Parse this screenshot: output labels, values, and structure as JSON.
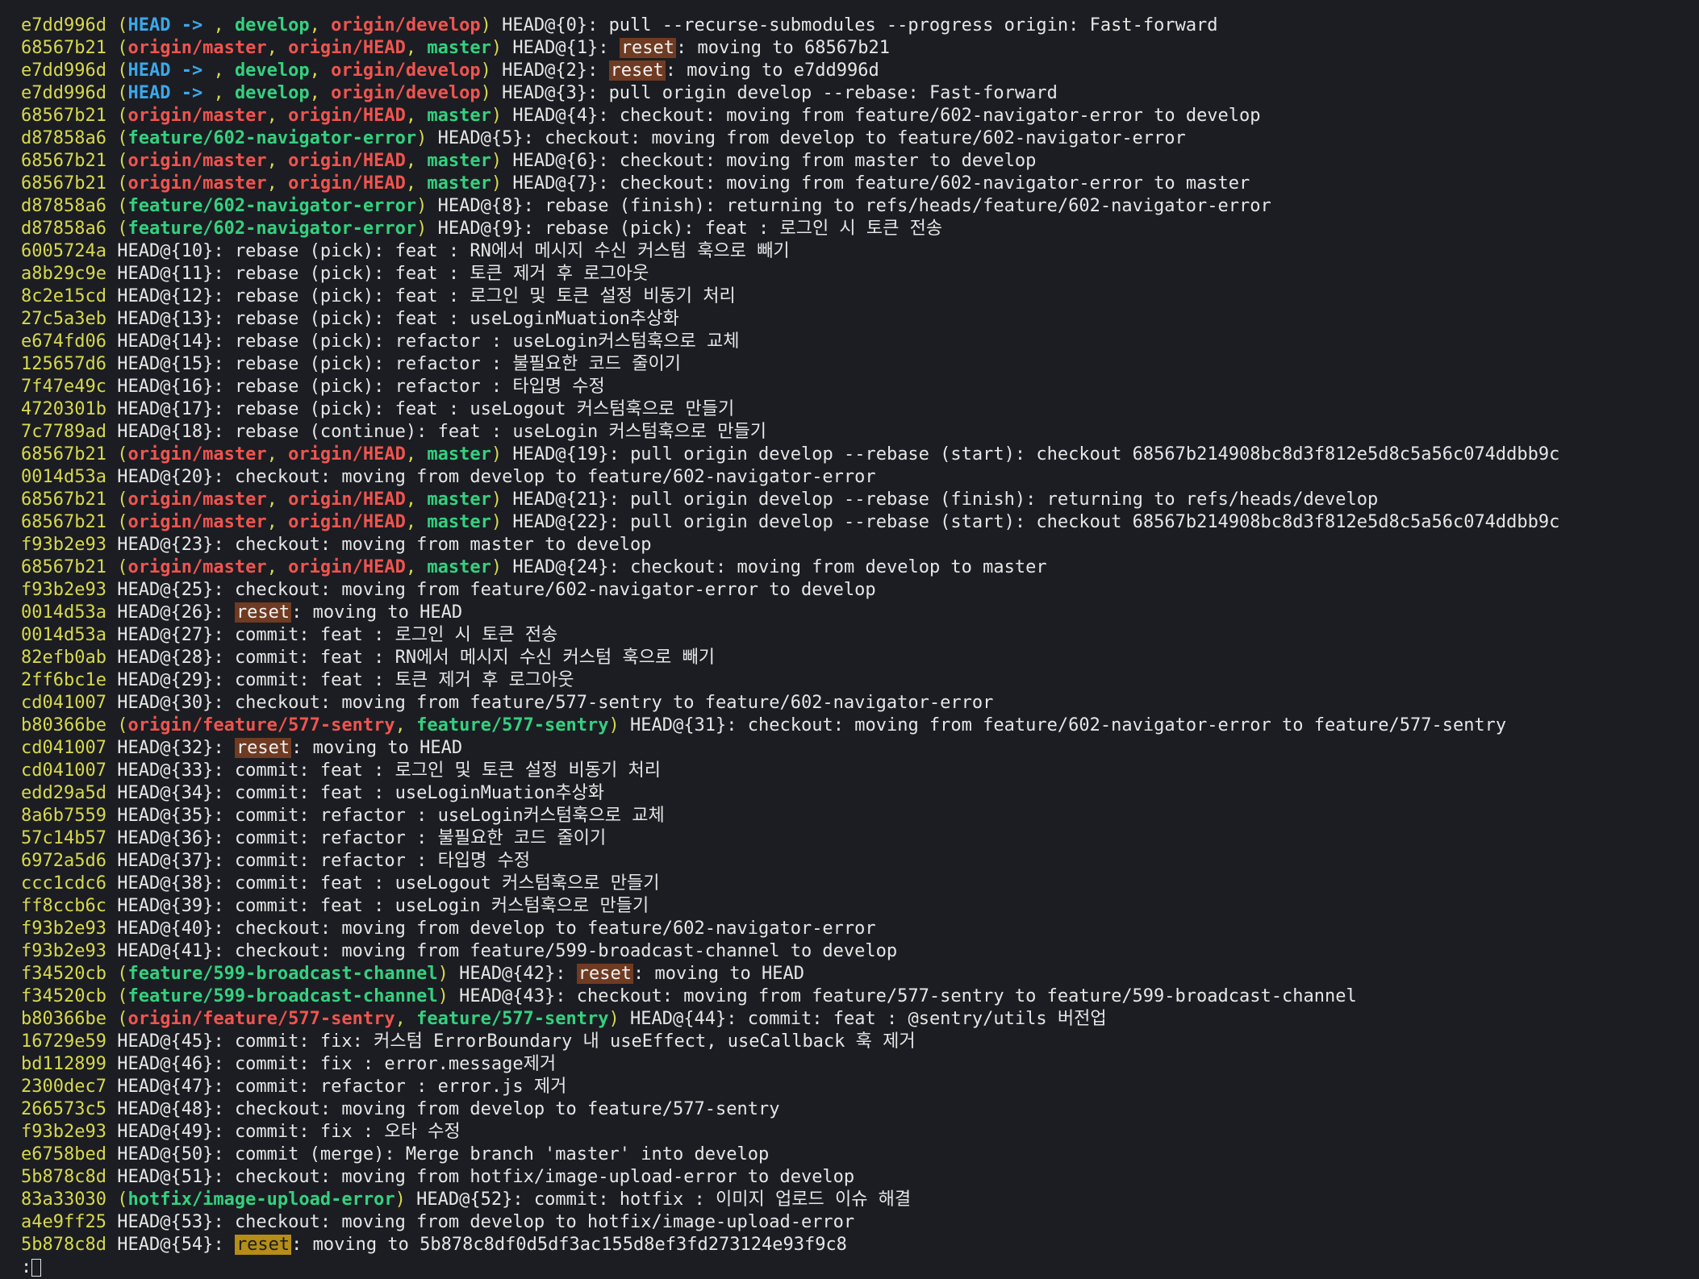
{
  "prompt": ":",
  "colors": {
    "hash": "#d7d84f",
    "head": "#3aa8ec",
    "local_branch": "#34d17f",
    "remote_branch": "#f0544f",
    "reset_highlight": "#6f3b22",
    "reset_highlight_active": "#b58d17",
    "background": "#1b1d22"
  },
  "entries": [
    {
      "hash": "e7dd996d",
      "refs": [
        {
          "text": "HEAD",
          "kind": "head",
          "arrow": true
        },
        {
          "text": "develop",
          "kind": "local"
        },
        {
          "text": "origin/develop",
          "kind": "remote"
        }
      ],
      "selector": "HEAD@{0}",
      "action": "pull --recurse-submodules --progress origin",
      "message": "Fast-forward"
    },
    {
      "hash": "68567b21",
      "refs": [
        {
          "text": "origin/master",
          "kind": "remote"
        },
        {
          "text": "origin/HEAD",
          "kind": "remote"
        },
        {
          "text": "master",
          "kind": "local"
        }
      ],
      "selector": "HEAD@{1}",
      "action": "reset",
      "message": "moving to 68567b21"
    },
    {
      "hash": "e7dd996d",
      "refs": [
        {
          "text": "HEAD",
          "kind": "head",
          "arrow": true
        },
        {
          "text": "develop",
          "kind": "local"
        },
        {
          "text": "origin/develop",
          "kind": "remote"
        }
      ],
      "selector": "HEAD@{2}",
      "action": "reset",
      "message": "moving to e7dd996d"
    },
    {
      "hash": "e7dd996d",
      "refs": [
        {
          "text": "HEAD",
          "kind": "head",
          "arrow": true
        },
        {
          "text": "develop",
          "kind": "local"
        },
        {
          "text": "origin/develop",
          "kind": "remote"
        }
      ],
      "selector": "HEAD@{3}",
      "action": "pull origin develop --rebase",
      "message": "Fast-forward"
    },
    {
      "hash": "68567b21",
      "refs": [
        {
          "text": "origin/master",
          "kind": "remote"
        },
        {
          "text": "origin/HEAD",
          "kind": "remote"
        },
        {
          "text": "master",
          "kind": "local"
        }
      ],
      "selector": "HEAD@{4}",
      "action": "checkout",
      "message": "moving from feature/602-navigator-error to develop"
    },
    {
      "hash": "d87858a6",
      "refs": [
        {
          "text": "feature/602-navigator-error",
          "kind": "local"
        }
      ],
      "selector": "HEAD@{5}",
      "action": "checkout",
      "message": "moving from develop to feature/602-navigator-error"
    },
    {
      "hash": "68567b21",
      "refs": [
        {
          "text": "origin/master",
          "kind": "remote"
        },
        {
          "text": "origin/HEAD",
          "kind": "remote"
        },
        {
          "text": "master",
          "kind": "local"
        }
      ],
      "selector": "HEAD@{6}",
      "action": "checkout",
      "message": "moving from master to develop"
    },
    {
      "hash": "68567b21",
      "refs": [
        {
          "text": "origin/master",
          "kind": "remote"
        },
        {
          "text": "origin/HEAD",
          "kind": "remote"
        },
        {
          "text": "master",
          "kind": "local"
        }
      ],
      "selector": "HEAD@{7}",
      "action": "checkout",
      "message": "moving from feature/602-navigator-error to master"
    },
    {
      "hash": "d87858a6",
      "refs": [
        {
          "text": "feature/602-navigator-error",
          "kind": "local"
        }
      ],
      "selector": "HEAD@{8}",
      "action": "rebase (finish)",
      "message": "returning to refs/heads/feature/602-navigator-error"
    },
    {
      "hash": "d87858a6",
      "refs": [
        {
          "text": "feature/602-navigator-error",
          "kind": "local"
        }
      ],
      "selector": "HEAD@{9}",
      "action": "rebase (pick)",
      "message": "feat : 로그인 시 토큰 전송"
    },
    {
      "hash": "6005724a",
      "refs": [],
      "selector": "HEAD@{10}",
      "action": "rebase (pick)",
      "message": "feat : RN에서 메시지 수신 커스텀 훅으로 빼기"
    },
    {
      "hash": "a8b29c9e",
      "refs": [],
      "selector": "HEAD@{11}",
      "action": "rebase (pick)",
      "message": "feat : 토큰 제거 후 로그아웃"
    },
    {
      "hash": "8c2e15cd",
      "refs": [],
      "selector": "HEAD@{12}",
      "action": "rebase (pick)",
      "message": "feat : 로그인 및 토큰 설정 비동기 처리"
    },
    {
      "hash": "27c5a3eb",
      "refs": [],
      "selector": "HEAD@{13}",
      "action": "rebase (pick)",
      "message": "feat : useLoginMuation추상화"
    },
    {
      "hash": "e674fd06",
      "refs": [],
      "selector": "HEAD@{14}",
      "action": "rebase (pick)",
      "message": "refactor : useLogin커스텀훅으로 교체"
    },
    {
      "hash": "125657d6",
      "refs": [],
      "selector": "HEAD@{15}",
      "action": "rebase (pick)",
      "message": "refactor : 불필요한 코드 줄이기"
    },
    {
      "hash": "7f47e49c",
      "refs": [],
      "selector": "HEAD@{16}",
      "action": "rebase (pick)",
      "message": "refactor : 타입명 수정"
    },
    {
      "hash": "4720301b",
      "refs": [],
      "selector": "HEAD@{17}",
      "action": "rebase (pick)",
      "message": "feat : useLogout 커스텀훅으로 만들기"
    },
    {
      "hash": "7c7789ad",
      "refs": [],
      "selector": "HEAD@{18}",
      "action": "rebase (continue)",
      "message": "feat : useLogin 커스텀훅으로 만들기"
    },
    {
      "hash": "68567b21",
      "refs": [
        {
          "text": "origin/master",
          "kind": "remote"
        },
        {
          "text": "origin/HEAD",
          "kind": "remote"
        },
        {
          "text": "master",
          "kind": "local"
        }
      ],
      "selector": "HEAD@{19}",
      "action": "pull origin develop --rebase (start)",
      "message": "checkout 68567b214908bc8d3f812e5d8c5a56c074ddbb9c"
    },
    {
      "hash": "0014d53a",
      "refs": [],
      "selector": "HEAD@{20}",
      "action": "checkout",
      "message": "moving from develop to feature/602-navigator-error"
    },
    {
      "hash": "68567b21",
      "refs": [
        {
          "text": "origin/master",
          "kind": "remote"
        },
        {
          "text": "origin/HEAD",
          "kind": "remote"
        },
        {
          "text": "master",
          "kind": "local"
        }
      ],
      "selector": "HEAD@{21}",
      "action": "pull origin develop --rebase (finish)",
      "message": "returning to refs/heads/develop"
    },
    {
      "hash": "68567b21",
      "refs": [
        {
          "text": "origin/master",
          "kind": "remote"
        },
        {
          "text": "origin/HEAD",
          "kind": "remote"
        },
        {
          "text": "master",
          "kind": "local"
        }
      ],
      "selector": "HEAD@{22}",
      "action": "pull origin develop --rebase (start)",
      "message": "checkout 68567b214908bc8d3f812e5d8c5a56c074ddbb9c"
    },
    {
      "hash": "f93b2e93",
      "refs": [],
      "selector": "HEAD@{23}",
      "action": "checkout",
      "message": "moving from master to develop"
    },
    {
      "hash": "68567b21",
      "refs": [
        {
          "text": "origin/master",
          "kind": "remote"
        },
        {
          "text": "origin/HEAD",
          "kind": "remote"
        },
        {
          "text": "master",
          "kind": "local"
        }
      ],
      "selector": "HEAD@{24}",
      "action": "checkout",
      "message": "moving from develop to master"
    },
    {
      "hash": "f93b2e93",
      "refs": [],
      "selector": "HEAD@{25}",
      "action": "checkout",
      "message": "moving from feature/602-navigator-error to develop"
    },
    {
      "hash": "0014d53a",
      "refs": [],
      "selector": "HEAD@{26}",
      "action": "reset",
      "message": "moving to HEAD"
    },
    {
      "hash": "0014d53a",
      "refs": [],
      "selector": "HEAD@{27}",
      "action": "commit",
      "message": "feat : 로그인 시 토큰 전송"
    },
    {
      "hash": "82efb0ab",
      "refs": [],
      "selector": "HEAD@{28}",
      "action": "commit",
      "message": "feat : RN에서 메시지 수신 커스텀 훅으로 빼기"
    },
    {
      "hash": "2ff6bc1e",
      "refs": [],
      "selector": "HEAD@{29}",
      "action": "commit",
      "message": "feat : 토큰 제거 후 로그아웃"
    },
    {
      "hash": "cd041007",
      "refs": [],
      "selector": "HEAD@{30}",
      "action": "checkout",
      "message": "moving from feature/577-sentry to feature/602-navigator-error"
    },
    {
      "hash": "b80366be",
      "refs": [
        {
          "text": "origin/feature/577-sentry",
          "kind": "remote"
        },
        {
          "text": "feature/577-sentry",
          "kind": "local"
        }
      ],
      "selector": "HEAD@{31}",
      "action": "checkout",
      "message": "moving from feature/602-navigator-error to feature/577-sentry"
    },
    {
      "hash": "cd041007",
      "refs": [],
      "selector": "HEAD@{32}",
      "action": "reset",
      "message": "moving to HEAD"
    },
    {
      "hash": "cd041007",
      "refs": [],
      "selector": "HEAD@{33}",
      "action": "commit",
      "message": "feat : 로그인 및 토큰 설정 비동기 처리"
    },
    {
      "hash": "edd29a5d",
      "refs": [],
      "selector": "HEAD@{34}",
      "action": "commit",
      "message": "feat : useLoginMuation추상화"
    },
    {
      "hash": "8a6b7559",
      "refs": [],
      "selector": "HEAD@{35}",
      "action": "commit",
      "message": "refactor : useLogin커스텀훅으로 교체"
    },
    {
      "hash": "57c14b57",
      "refs": [],
      "selector": "HEAD@{36}",
      "action": "commit",
      "message": "refactor : 불필요한 코드 줄이기"
    },
    {
      "hash": "6972a5d6",
      "refs": [],
      "selector": "HEAD@{37}",
      "action": "commit",
      "message": "refactor : 타입명 수정"
    },
    {
      "hash": "ccc1cdc6",
      "refs": [],
      "selector": "HEAD@{38}",
      "action": "commit",
      "message": "feat : useLogout 커스텀훅으로 만들기"
    },
    {
      "hash": "ff8ccb6c",
      "refs": [],
      "selector": "HEAD@{39}",
      "action": "commit",
      "message": "feat : useLogin 커스텀훅으로 만들기"
    },
    {
      "hash": "f93b2e93",
      "refs": [],
      "selector": "HEAD@{40}",
      "action": "checkout",
      "message": "moving from develop to feature/602-navigator-error"
    },
    {
      "hash": "f93b2e93",
      "refs": [],
      "selector": "HEAD@{41}",
      "action": "checkout",
      "message": "moving from feature/599-broadcast-channel to develop"
    },
    {
      "hash": "f34520cb",
      "refs": [
        {
          "text": "feature/599-broadcast-channel",
          "kind": "local"
        }
      ],
      "selector": "HEAD@{42}",
      "action": "reset",
      "message": "moving to HEAD"
    },
    {
      "hash": "f34520cb",
      "refs": [
        {
          "text": "feature/599-broadcast-channel",
          "kind": "local"
        }
      ],
      "selector": "HEAD@{43}",
      "action": "checkout",
      "message": "moving from feature/577-sentry to feature/599-broadcast-channel"
    },
    {
      "hash": "b80366be",
      "refs": [
        {
          "text": "origin/feature/577-sentry",
          "kind": "remote"
        },
        {
          "text": "feature/577-sentry",
          "kind": "local"
        }
      ],
      "selector": "HEAD@{44}",
      "action": "commit",
      "message": "feat : @sentry/utils 버전업"
    },
    {
      "hash": "16729e59",
      "refs": [],
      "selector": "HEAD@{45}",
      "action": "commit",
      "message": "fix: 커스텀 ErrorBoundary 내 useEffect, useCallback 훅 제거"
    },
    {
      "hash": "bd112899",
      "refs": [],
      "selector": "HEAD@{46}",
      "action": "commit",
      "message": "fix : error.message제거"
    },
    {
      "hash": "2300dec7",
      "refs": [],
      "selector": "HEAD@{47}",
      "action": "commit",
      "message": "refactor : error.js 제거"
    },
    {
      "hash": "266573c5",
      "refs": [],
      "selector": "HEAD@{48}",
      "action": "checkout",
      "message": "moving from develop to feature/577-sentry"
    },
    {
      "hash": "f93b2e93",
      "refs": [],
      "selector": "HEAD@{49}",
      "action": "commit",
      "message": "fix : 오타 수정"
    },
    {
      "hash": "e6758bed",
      "refs": [],
      "selector": "HEAD@{50}",
      "action": "commit (merge)",
      "message": "Merge branch 'master' into develop"
    },
    {
      "hash": "5b878c8d",
      "refs": [],
      "selector": "HEAD@{51}",
      "action": "checkout",
      "message": "moving from hotfix/image-upload-error to develop"
    },
    {
      "hash": "83a33030",
      "refs": [
        {
          "text": "hotfix/image-upload-error",
          "kind": "local"
        }
      ],
      "selector": "HEAD@{52}",
      "action": "commit",
      "message": "hotfix : 이미지 업로드 이슈 해결"
    },
    {
      "hash": "a4e9ff25",
      "refs": [],
      "selector": "HEAD@{53}",
      "action": "checkout",
      "message": "moving from develop to hotfix/image-upload-error"
    },
    {
      "hash": "5b878c8d",
      "refs": [],
      "selector": "HEAD@{54}",
      "action": "reset",
      "message": "moving to 5b878c8df0d5df3ac155d8ef3fd273124e93f9c8",
      "active": true
    }
  ]
}
